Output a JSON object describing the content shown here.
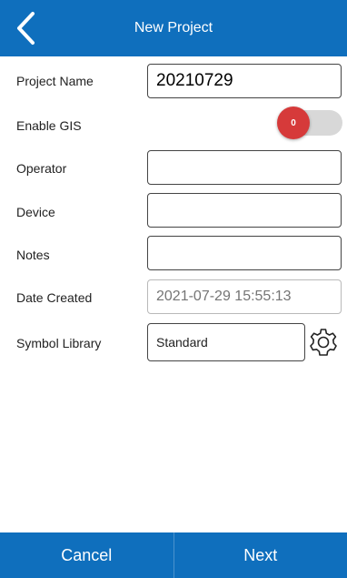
{
  "header": {
    "title": "New Project",
    "back_icon": "chevron-left-icon"
  },
  "form": {
    "project_name": {
      "label": "Project Name",
      "value": "20210729"
    },
    "enable_gis": {
      "label": "Enable GIS",
      "toggle_text": "0",
      "state": "off"
    },
    "operator": {
      "label": "Operator",
      "value": ""
    },
    "device": {
      "label": "Device",
      "value": ""
    },
    "notes": {
      "label": "Notes",
      "value": ""
    },
    "date_created": {
      "label": "Date Created",
      "placeholder": "2021-07-29 15:55:13"
    },
    "symbol_library": {
      "label": "Symbol Library",
      "value": "Standard",
      "settings_icon": "gear-icon"
    }
  },
  "footer": {
    "cancel_label": "Cancel",
    "next_label": "Next"
  },
  "colors": {
    "primary": "#0f6fbd",
    "toggle_knob": "#d63a3a",
    "toggle_track": "#d8d8d8"
  }
}
